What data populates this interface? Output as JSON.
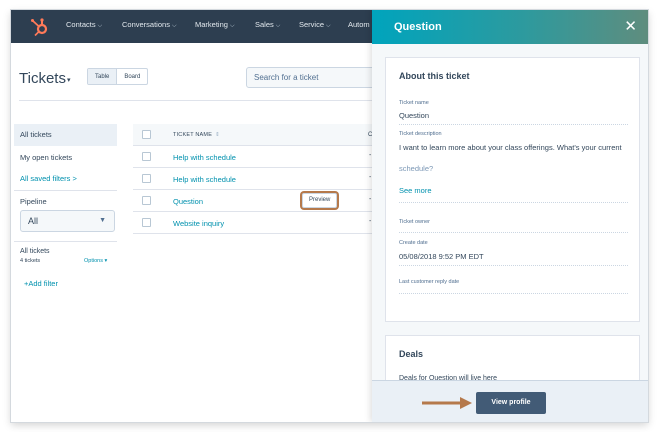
{
  "topnav": {
    "items": [
      {
        "label": "Contacts"
      },
      {
        "label": "Conversations"
      },
      {
        "label": "Marketing"
      },
      {
        "label": "Sales"
      },
      {
        "label": "Service"
      },
      {
        "label": "Autom"
      }
    ]
  },
  "page": {
    "title": "Tickets",
    "view_tabs": [
      "Table",
      "Board"
    ],
    "search_placeholder": "Search for a ticket"
  },
  "sidebar": {
    "all_tickets": "All tickets",
    "my_open": "My open tickets",
    "saved_filters": "All saved filters >",
    "pipeline_label": "Pipeline",
    "pipeline_value": "All",
    "view_title": "All tickets",
    "ticket_count": "4 tickets",
    "options": "Options",
    "add_filter": "+Add filter"
  },
  "table": {
    "header": "TICKET NAME",
    "header_next": "C",
    "rows": [
      {
        "name": "Help with schedule",
        "value": "-"
      },
      {
        "name": "Help with schedule",
        "value": "-"
      },
      {
        "name": "Question",
        "value": "-"
      },
      {
        "name": "Website inquiry",
        "value": "-"
      }
    ],
    "preview_label": "Preview"
  },
  "panel": {
    "title": "Question",
    "about": {
      "title": "About this ticket",
      "name_label": "Ticket name",
      "name_value": "Question",
      "desc_label": "Ticket description",
      "desc_value": "I want to learn more about your class offerings. What's your current",
      "desc_fade": "schedule?",
      "see_more": "See more",
      "owner_label": "Ticket owner",
      "create_label": "Create date",
      "create_value": "05/08/2018 9:52 PM EDT",
      "last_reply_label": "Last customer reply date"
    },
    "deals": {
      "title": "Deals",
      "text": "Deals for Question will live here"
    },
    "footer_button": "View profile"
  },
  "colors": {
    "nav_bg": "#2d3e50",
    "link": "#0091ae",
    "accent_orange": "#b5794b",
    "header_gradient_start": "#00a4bd",
    "header_gradient_end": "#5f8d7e",
    "button_dark": "#425b76"
  },
  "icons": [
    "hubspot-logo-icon",
    "close-icon",
    "sort-icon",
    "caret-down-icon",
    "arrow-right-icon"
  ]
}
